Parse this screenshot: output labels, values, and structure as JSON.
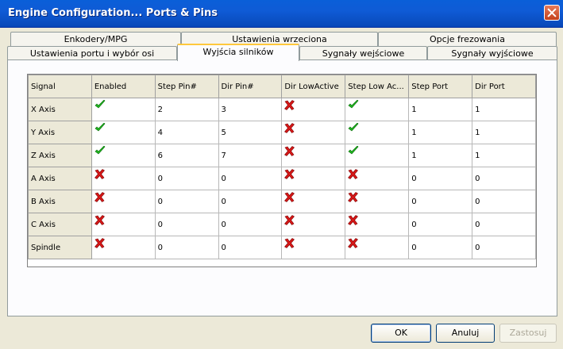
{
  "window": {
    "title": "Engine Configuration... Ports & Pins"
  },
  "tabs_row1": [
    {
      "label": "Enkodery/MPG"
    },
    {
      "label": "Ustawienia wrzeciona"
    },
    {
      "label": "Opcje frezowania"
    }
  ],
  "tabs_row2": [
    {
      "label": "Ustawienia portu i wybór osi"
    },
    {
      "label": "Wyjścia silników",
      "active": true
    },
    {
      "label": "Sygnały wejściowe"
    },
    {
      "label": "Sygnały wyjściowe"
    }
  ],
  "grid": {
    "columns": [
      "Signal",
      "Enabled",
      "Step Pin#",
      "Dir Pin#",
      "Dir LowActive",
      "Step Low Ac...",
      "Step Port",
      "Dir Port"
    ],
    "rows": [
      {
        "signal": "X Axis",
        "enabled": "check",
        "step_pin": "2",
        "dir_pin": "3",
        "dir_low": "cross",
        "step_low": "check",
        "step_port": "1",
        "dir_port": "1"
      },
      {
        "signal": "Y Axis",
        "enabled": "check",
        "step_pin": "4",
        "dir_pin": "5",
        "dir_low": "cross",
        "step_low": "check",
        "step_port": "1",
        "dir_port": "1"
      },
      {
        "signal": "Z Axis",
        "enabled": "check",
        "step_pin": "6",
        "dir_pin": "7",
        "dir_low": "cross",
        "step_low": "check",
        "step_port": "1",
        "dir_port": "1"
      },
      {
        "signal": "A Axis",
        "enabled": "cross",
        "step_pin": "0",
        "dir_pin": "0",
        "dir_low": "cross",
        "step_low": "cross",
        "step_port": "0",
        "dir_port": "0"
      },
      {
        "signal": "B Axis",
        "enabled": "cross",
        "step_pin": "0",
        "dir_pin": "0",
        "dir_low": "cross",
        "step_low": "cross",
        "step_port": "0",
        "dir_port": "0"
      },
      {
        "signal": "C Axis",
        "enabled": "cross",
        "step_pin": "0",
        "dir_pin": "0",
        "dir_low": "cross",
        "step_low": "cross",
        "step_port": "0",
        "dir_port": "0"
      },
      {
        "signal": "Spindle",
        "enabled": "cross",
        "step_pin": "0",
        "dir_pin": "0",
        "dir_low": "cross",
        "step_low": "cross",
        "step_port": "0",
        "dir_port": "0"
      }
    ]
  },
  "buttons": {
    "ok": "OK",
    "cancel": "Anuluj",
    "apply": "Zastosuj"
  },
  "colors": {
    "check": "#1fb81f",
    "cross": "#d81818",
    "titlebar": "#0a5fd8"
  }
}
